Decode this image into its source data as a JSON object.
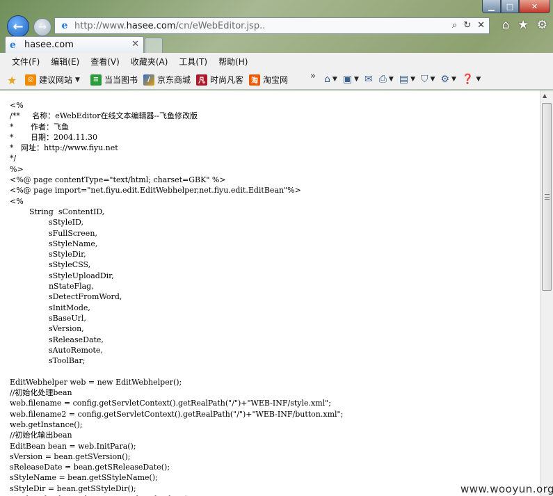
{
  "window": {
    "controls": {
      "minimize": "▁",
      "maximize": "□",
      "close": "✕"
    }
  },
  "navigation": {
    "back_icon": "←",
    "forward_icon": "→",
    "address": {
      "prefix": "http://www.",
      "host": "hasee.com",
      "path": "/cn/eWebEditor.jsp..",
      "search_icon": "⌕",
      "refresh_icon": "↻",
      "stop_icon": "✕"
    },
    "right_icons": {
      "home": "⌂",
      "favorites": "★",
      "tools": "⚙"
    }
  },
  "tab": {
    "label": "hasee.com",
    "close": "✕"
  },
  "menu": [
    "文件(F)",
    "编辑(E)",
    "查看(V)",
    "收藏夹(A)",
    "工具(T)",
    "帮助(H)"
  ],
  "favorites": [
    {
      "label": "建议网站",
      "icon_color": "#f28a00",
      "has_dropdown": true
    },
    {
      "label": "当当图书",
      "icon_color": "#2a9d3a",
      "has_dropdown": false
    },
    {
      "label": "京东商城",
      "icon_color": "#e6a000",
      "has_dropdown": false
    },
    {
      "label": "时尚凡客",
      "icon_color": "#b0182b",
      "has_dropdown": false
    },
    {
      "label": "淘宝网",
      "icon_color": "#f05a00",
      "has_dropdown": false
    }
  ],
  "favbar_more": "»",
  "toolbar_more": "»",
  "code_lines": [
    "<%",
    "/**     名称：eWebEditor在线文本编辑器--飞鱼修改版",
    "*       作者：飞鱼",
    "*       日期：2004.11.30",
    "*   网址：http://www.fiyu.net",
    "*/",
    "%>",
    "<%@ page contentType=\"text/html; charset=GBK\" %>",
    "<%@ page import=\"net.fiyu.edit.EditWebhelper,net.fiyu.edit.EditBean\"%>",
    "<%",
    "        String  sContentID,",
    "                sStyleID,",
    "                sFullScreen,",
    "                sStyleName,",
    "                sStyleDir,",
    "                sStyleCSS,",
    "                sStyleUploadDir,",
    "                nStateFlag,",
    "                sDetectFromWord,",
    "                sInitMode,",
    "                sBaseUrl,",
    "                sVersion,",
    "                sReleaseDate,",
    "                sAutoRemote,",
    "                sToolBar;",
    "",
    "EditWebhelper web = new EditWebhelper();",
    "//初始化处理bean",
    "web.filename = config.getServletContext().getRealPath(\"/\")+\"WEB-INF/style.xml\";",
    "web.filename2 = config.getServletContext().getRealPath(\"/\")+\"WEB-INF/button.xml\";",
    "web.getInstance();",
    "//初始化输出bean",
    "EditBean bean = web.InitPara();",
    "sVersion = bean.getSVersion();",
    "sReleaseDate = bean.getSReleaseDate();",
    "sStyleName = bean.getSStyleName();",
    "sStyleDir = bean.getSStyleDir();",
    "sStyleUploadDir = bean.getSStyleUploadDir();"
  ],
  "watermark": "www.wooyun.org"
}
